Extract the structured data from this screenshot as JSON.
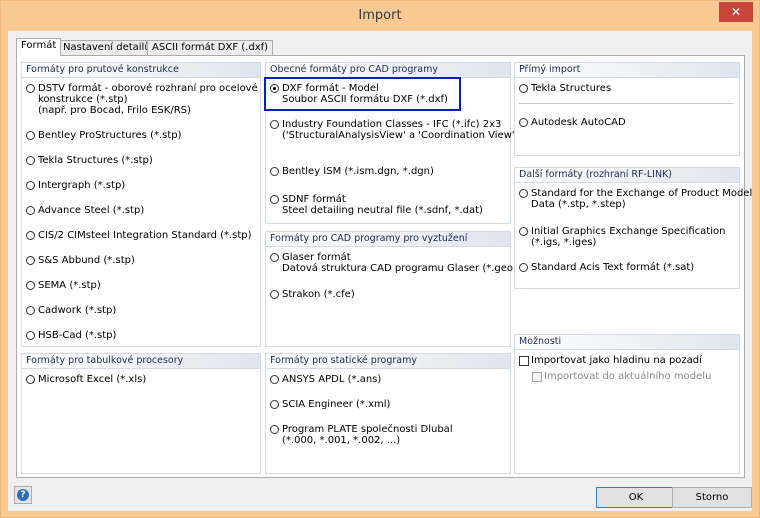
{
  "window": {
    "title": "Import",
    "close_glyph": "✕"
  },
  "tabs": [
    {
      "label": "Formát",
      "active": true
    },
    {
      "label": "Nastavení detailů",
      "active": false
    },
    {
      "label": "ASCII formát DXF (.dxf)",
      "active": false
    }
  ],
  "groups": {
    "prutove": {
      "title": "Formáty pro prutové konstrukce",
      "options": [
        {
          "lines": [
            "DSTV formát - oborové rozhraní pro ocelové",
            "konstrukce (*.stp)",
            "(např. pro Bocad, Frilo ESK/RS)"
          ],
          "checked": false
        },
        {
          "lines": [
            "Bentley ProStructures (*.stp)"
          ],
          "checked": false
        },
        {
          "lines": [
            "Tekla Structures (*.stp)"
          ],
          "checked": false
        },
        {
          "lines": [
            "Intergraph (*.stp)"
          ],
          "checked": false
        },
        {
          "lines": [
            "Advance Steel (*.stp)"
          ],
          "checked": false
        },
        {
          "lines": [
            "CIS/2 CIMsteel Integration Standard (*.stp)"
          ],
          "checked": false
        },
        {
          "lines": [
            "S&S Abbund (*.stp)"
          ],
          "checked": false
        },
        {
          "lines": [
            "SEMA (*.stp)"
          ],
          "checked": false
        },
        {
          "lines": [
            "Cadwork (*.stp)"
          ],
          "checked": false
        },
        {
          "lines": [
            "HSB-Cad (*.stp)"
          ],
          "checked": false
        }
      ]
    },
    "tabulkove": {
      "title": "Formáty pro tabulkové procesory",
      "options": [
        {
          "lines": [
            "Microsoft Excel (*.xls)"
          ],
          "checked": false
        }
      ]
    },
    "cad": {
      "title": "Obecné formáty pro CAD programy",
      "options": [
        {
          "lines": [
            "DXF formát - Model",
            "Soubor ASCII formátu DXF (*.dxf)"
          ],
          "checked": true
        },
        {
          "lines": [
            "Industry Foundation Classes - IFC (*.ifc) 2x3",
            "('StructuralAnalysisView' a 'Coordination View')"
          ],
          "checked": false
        },
        {
          "lines": [
            "Bentley ISM (*.ism.dgn, *.dgn)"
          ],
          "checked": false
        },
        {
          "lines": [
            "SDNF formát",
            "Steel detailing neutral file (*.sdnf, *.dat)"
          ],
          "checked": false
        }
      ]
    },
    "vyztuzeni": {
      "title": "Formáty pro CAD programy pro vyztužení",
      "options": [
        {
          "lines": [
            "Glaser formát",
            "Datová struktura CAD programu Glaser (*.geo)"
          ],
          "checked": false
        },
        {
          "lines": [
            "Strakon (*.cfe)"
          ],
          "checked": false
        }
      ]
    },
    "staticke": {
      "title": "Formáty pro statické programy",
      "options": [
        {
          "lines": [
            "ANSYS APDL (*.ans)"
          ],
          "checked": false
        },
        {
          "lines": [
            "SCIA Engineer (*.xml)"
          ],
          "checked": false
        },
        {
          "lines": [
            "Program PLATE společnosti Dlubal",
            "(*.000, *.001, *.002, ...)"
          ],
          "checked": false
        }
      ]
    },
    "primy": {
      "title": "Přímý import",
      "options": [
        {
          "lines": [
            "Tekla Structures"
          ],
          "checked": false
        },
        {
          "lines": [
            "Autodesk AutoCAD"
          ],
          "checked": false
        }
      ]
    },
    "rflink": {
      "title": "Další formáty (rozhraní RF-LINK)",
      "options": [
        {
          "lines": [
            "Standard for the Exchange of Product Model",
            "Data (*.stp, *.step)"
          ],
          "checked": false
        },
        {
          "lines": [
            "Initial Graphics Exchange Specification",
            "(*.igs, *.iges)"
          ],
          "checked": false
        },
        {
          "lines": [
            "Standard Acis Text formát (*.sat)"
          ],
          "checked": false
        }
      ]
    },
    "moznosti": {
      "title": "Možnosti",
      "checkboxes": [
        {
          "label": "Importovat jako hladinu na pozadí",
          "checked": false,
          "enabled": true
        },
        {
          "label": "Importovat do aktuálního modelu",
          "checked": false,
          "enabled": false
        }
      ]
    }
  },
  "footer": {
    "help_glyph": "?",
    "ok_label": "OK",
    "cancel_label": "Storno"
  },
  "colors": {
    "title_bar": "#f8c993",
    "close_button": "#c7453b",
    "highlight": "#0a21b5"
  }
}
